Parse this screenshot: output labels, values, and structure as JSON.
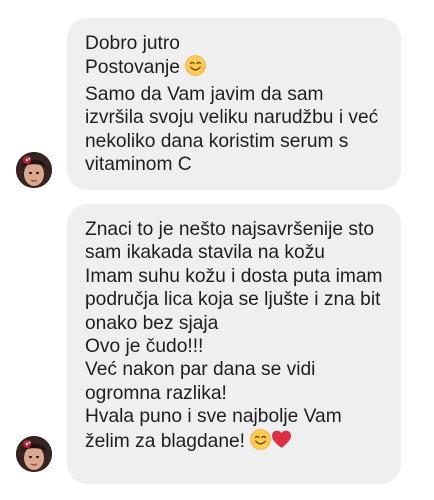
{
  "messages": [
    {
      "lines": [
        "Dobro jutro",
        "Postovanje",
        "Samo da Vam javim da sam",
        "izvršila svoju veliku narudžbu i već",
        "nekoliko dana koristim serum s",
        "vitaminom C"
      ],
      "avatar_icon": "user-avatar"
    },
    {
      "lines": [
        "Znaci to je nešto najsavršenije sto",
        "sam ikakada stavila na kožu",
        "Imam suhu kožu i dosta puta imam",
        "područja lica koja se ljušte i zna bit",
        "onako bez sjaja",
        "Ovo je čudo!!!",
        "Već nakon par dana se vidi",
        "ogromna razlika!",
        "Hvala puno i sve najbolje Vam",
        "želim za blagdane!"
      ],
      "avatar_icon": "user-avatar"
    }
  ],
  "icons": {
    "smile": "smiling-face-emoji",
    "heart": "red-heart-emoji"
  },
  "colors": {
    "bubble": "#efefef",
    "text": "#1c1e21",
    "emoji_face": "#ffcc4d",
    "heart": "#dd2e44"
  }
}
